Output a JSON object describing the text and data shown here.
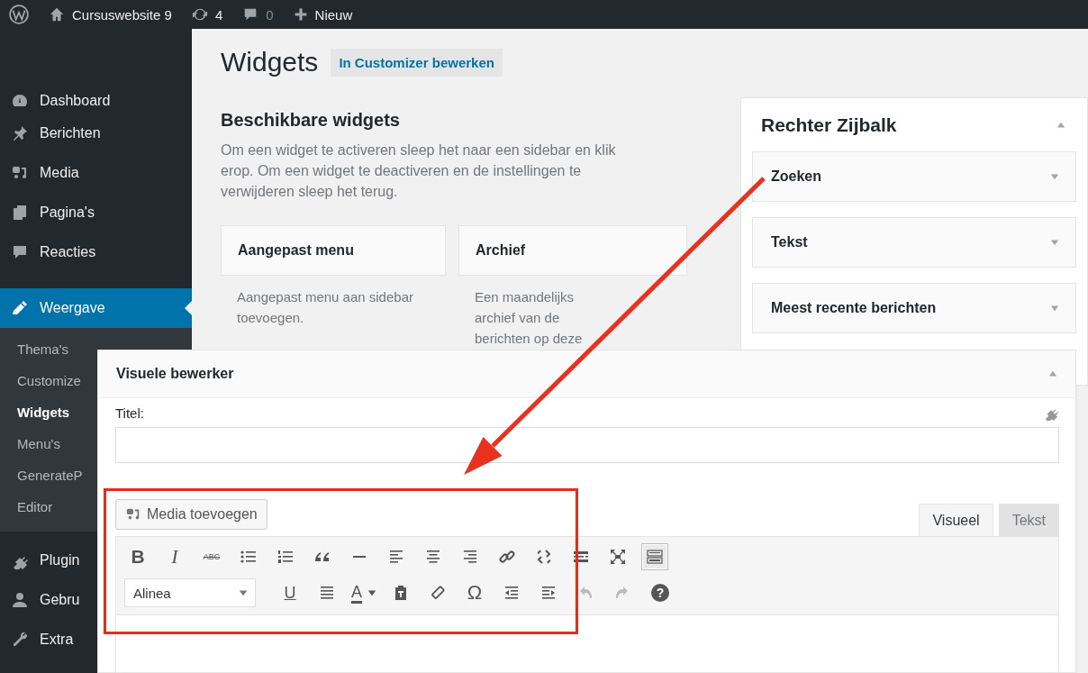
{
  "admin_bar": {
    "site_name": "Cursuswebsite 9",
    "updates": "4",
    "comments": "0",
    "new_label": "Nieuw"
  },
  "sidebar": {
    "items": [
      {
        "label": "Dashboard",
        "selected": false
      },
      {
        "label": "Berichten",
        "selected": false
      },
      {
        "label": "Media",
        "selected": false
      },
      {
        "label": "Pagina's",
        "selected": false
      },
      {
        "label": "Reacties",
        "selected": false
      },
      {
        "label": "Weergave",
        "selected": true,
        "children": [
          {
            "label": "Thema's",
            "selected": false
          },
          {
            "label": "Customize",
            "selected": false
          },
          {
            "label": "Widgets",
            "selected": true
          },
          {
            "label": "Menu's",
            "selected": false
          },
          {
            "label": "GenerateP",
            "selected": false
          },
          {
            "label": "Editor",
            "selected": false
          }
        ]
      },
      {
        "label": "Plugin",
        "selected": false
      },
      {
        "label": "Gebru",
        "selected": false
      },
      {
        "label": "Extra",
        "selected": false
      }
    ]
  },
  "page": {
    "title": "Widgets",
    "action": "In Customizer bewerken"
  },
  "available_widgets": {
    "heading": "Beschikbare widgets",
    "description": "Om een widget te activeren sleep het naar een sidebar en klik erop. Om een widget te deactiveren en de instellingen te verwijderen sleep het terug.",
    "widgets": [
      {
        "title": "Aangepast menu",
        "description": "Aangepast menu aan sidebar toevoegen."
      },
      {
        "title": "Archief",
        "description": "Een maandelijks archief van de berichten op deze"
      }
    ]
  },
  "widget_area": {
    "title": "Rechter Zijbalk",
    "expanded": true,
    "widgets": [
      {
        "title": "Zoeken",
        "expanded": false
      },
      {
        "title": "Tekst",
        "expanded": false
      },
      {
        "title": "Meest recente berichten",
        "expanded": false
      }
    ]
  },
  "editor_widget": {
    "title": "Visuele bewerker",
    "expanded": true,
    "title_label": "Titel:",
    "media_button": "Media toevoegen",
    "tabs": [
      {
        "label": "Visueel",
        "selected": true
      },
      {
        "label": "Tekst",
        "selected": false
      }
    ],
    "toolbar": [
      [
        {
          "kind": "bold",
          "glyph": "B",
          "pressed": false,
          "disabled": false
        },
        {
          "kind": "italic",
          "glyph": "I",
          "pressed": false,
          "disabled": false
        },
        {
          "kind": "strike",
          "glyph": "ABC",
          "pressed": false,
          "disabled": false
        },
        {
          "kind": "bullet-list",
          "pressed": false,
          "disabled": false
        },
        {
          "kind": "numbered-list",
          "pressed": false,
          "disabled": false
        },
        {
          "kind": "quote",
          "pressed": false,
          "disabled": false
        },
        {
          "kind": "hr",
          "pressed": false,
          "disabled": false
        },
        {
          "kind": "align-left",
          "pressed": false,
          "disabled": false
        },
        {
          "kind": "align-center",
          "pressed": false,
          "disabled": false
        },
        {
          "kind": "align-right",
          "pressed": false,
          "disabled": false
        },
        {
          "kind": "link",
          "pressed": false,
          "disabled": false
        },
        {
          "kind": "unlink",
          "pressed": false,
          "disabled": false
        },
        {
          "kind": "more",
          "pressed": false,
          "disabled": false
        },
        {
          "kind": "fullscreen",
          "pressed": false,
          "disabled": false
        },
        {
          "kind": "toolbar-toggle",
          "pressed": true,
          "disabled": false
        }
      ],
      [
        {
          "kind": "format-select",
          "value": "Alinea",
          "pressed": false,
          "disabled": false
        },
        {
          "kind": "underline",
          "glyph": "U",
          "pressed": false,
          "disabled": false
        },
        {
          "kind": "justify",
          "pressed": false,
          "disabled": false
        },
        {
          "kind": "text-color",
          "glyph": "A",
          "pressed": false,
          "disabled": false
        },
        {
          "kind": "paste-text",
          "pressed": false,
          "disabled": false
        },
        {
          "kind": "eraser",
          "pressed": false,
          "disabled": false
        },
        {
          "kind": "omega",
          "glyph": "Ω",
          "pressed": false,
          "disabled": false
        },
        {
          "kind": "outdent",
          "pressed": false,
          "disabled": false
        },
        {
          "kind": "indent",
          "pressed": false,
          "disabled": false
        },
        {
          "kind": "undo",
          "pressed": false,
          "disabled": true
        },
        {
          "kind": "redo",
          "pressed": false,
          "disabled": true
        },
        {
          "kind": "help",
          "glyph": "?",
          "pressed": false,
          "disabled": false
        }
      ]
    ]
  }
}
